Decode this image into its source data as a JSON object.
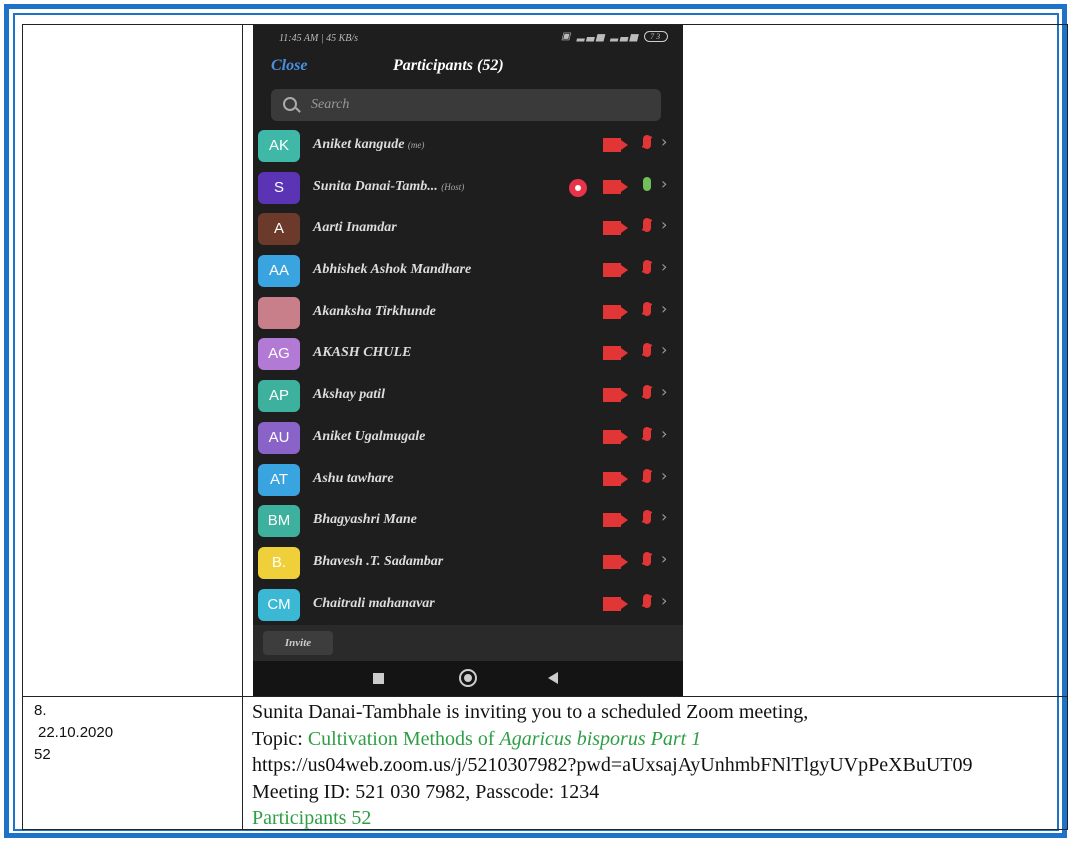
{
  "phone": {
    "status_time": "11:45 AM | 45 KB/s",
    "status_icons": "▣ ▂▃▅ ▂▃▅",
    "battery": "73",
    "close_label": "Close",
    "title": "Participants (52)",
    "search_placeholder": "Search",
    "participants": [
      {
        "initials": "AK",
        "name": "Aniket kangude",
        "tag": "(me)",
        "color": "#3fb8a8"
      },
      {
        "initials": "S",
        "name": "Sunita Danai-Tamb...",
        "tag": "(Host)",
        "color": "#5b34b5",
        "host": true
      },
      {
        "initials": "A",
        "name": "Aarti Inamdar",
        "tag": "",
        "color": "#6b3a2a"
      },
      {
        "initials": "AA",
        "name": "Abhishek Ashok Mandhare",
        "tag": "",
        "color": "#3aa4e0"
      },
      {
        "initials": "",
        "name": "Akanksha Tirkhunde",
        "tag": "",
        "color": "#c97f8a"
      },
      {
        "initials": "AG",
        "name": "AKASH CHULE",
        "tag": "",
        "color": "#b27ad4"
      },
      {
        "initials": "AP",
        "name": "Akshay patil",
        "tag": "",
        "color": "#3db19d"
      },
      {
        "initials": "AU",
        "name": "Aniket Ugalmugale",
        "tag": "",
        "color": "#8a63c9"
      },
      {
        "initials": "AT",
        "name": "Ashu tawhare",
        "tag": "",
        "color": "#3aa4e0"
      },
      {
        "initials": "BM",
        "name": "Bhagyashri Mane",
        "tag": "",
        "color": "#3db19d"
      },
      {
        "initials": "B.",
        "name": "Bhavesh .T. Sadambar",
        "tag": "",
        "color": "#f0d03a"
      },
      {
        "initials": "CM",
        "name": "Chaitrali mahanavar",
        "tag": "",
        "color": "#3ab8d4"
      }
    ],
    "invite_label": "Invite"
  },
  "record": {
    "number": "8.",
    "date": "22.10.2020",
    "count": "52",
    "line1": "Sunita Danai-Tambhale is inviting you to a scheduled Zoom meeting,",
    "topic_label": "Topic:",
    "topic_text": "Cultivation Methods of ",
    "topic_italic": "Agaricus bisporus Part 1",
    "url": "https://us04web.zoom.us/j/5210307982?pwd=aUxsajAyUnhmbFNlTlgyUVpPeXBuUT09",
    "meeting": "Meeting ID: 521 030 7982, Passcode: 1234",
    "participants": "Participants 52"
  },
  "colors": {
    "frame": "#1e73c8",
    "green": "#2e9e45"
  }
}
